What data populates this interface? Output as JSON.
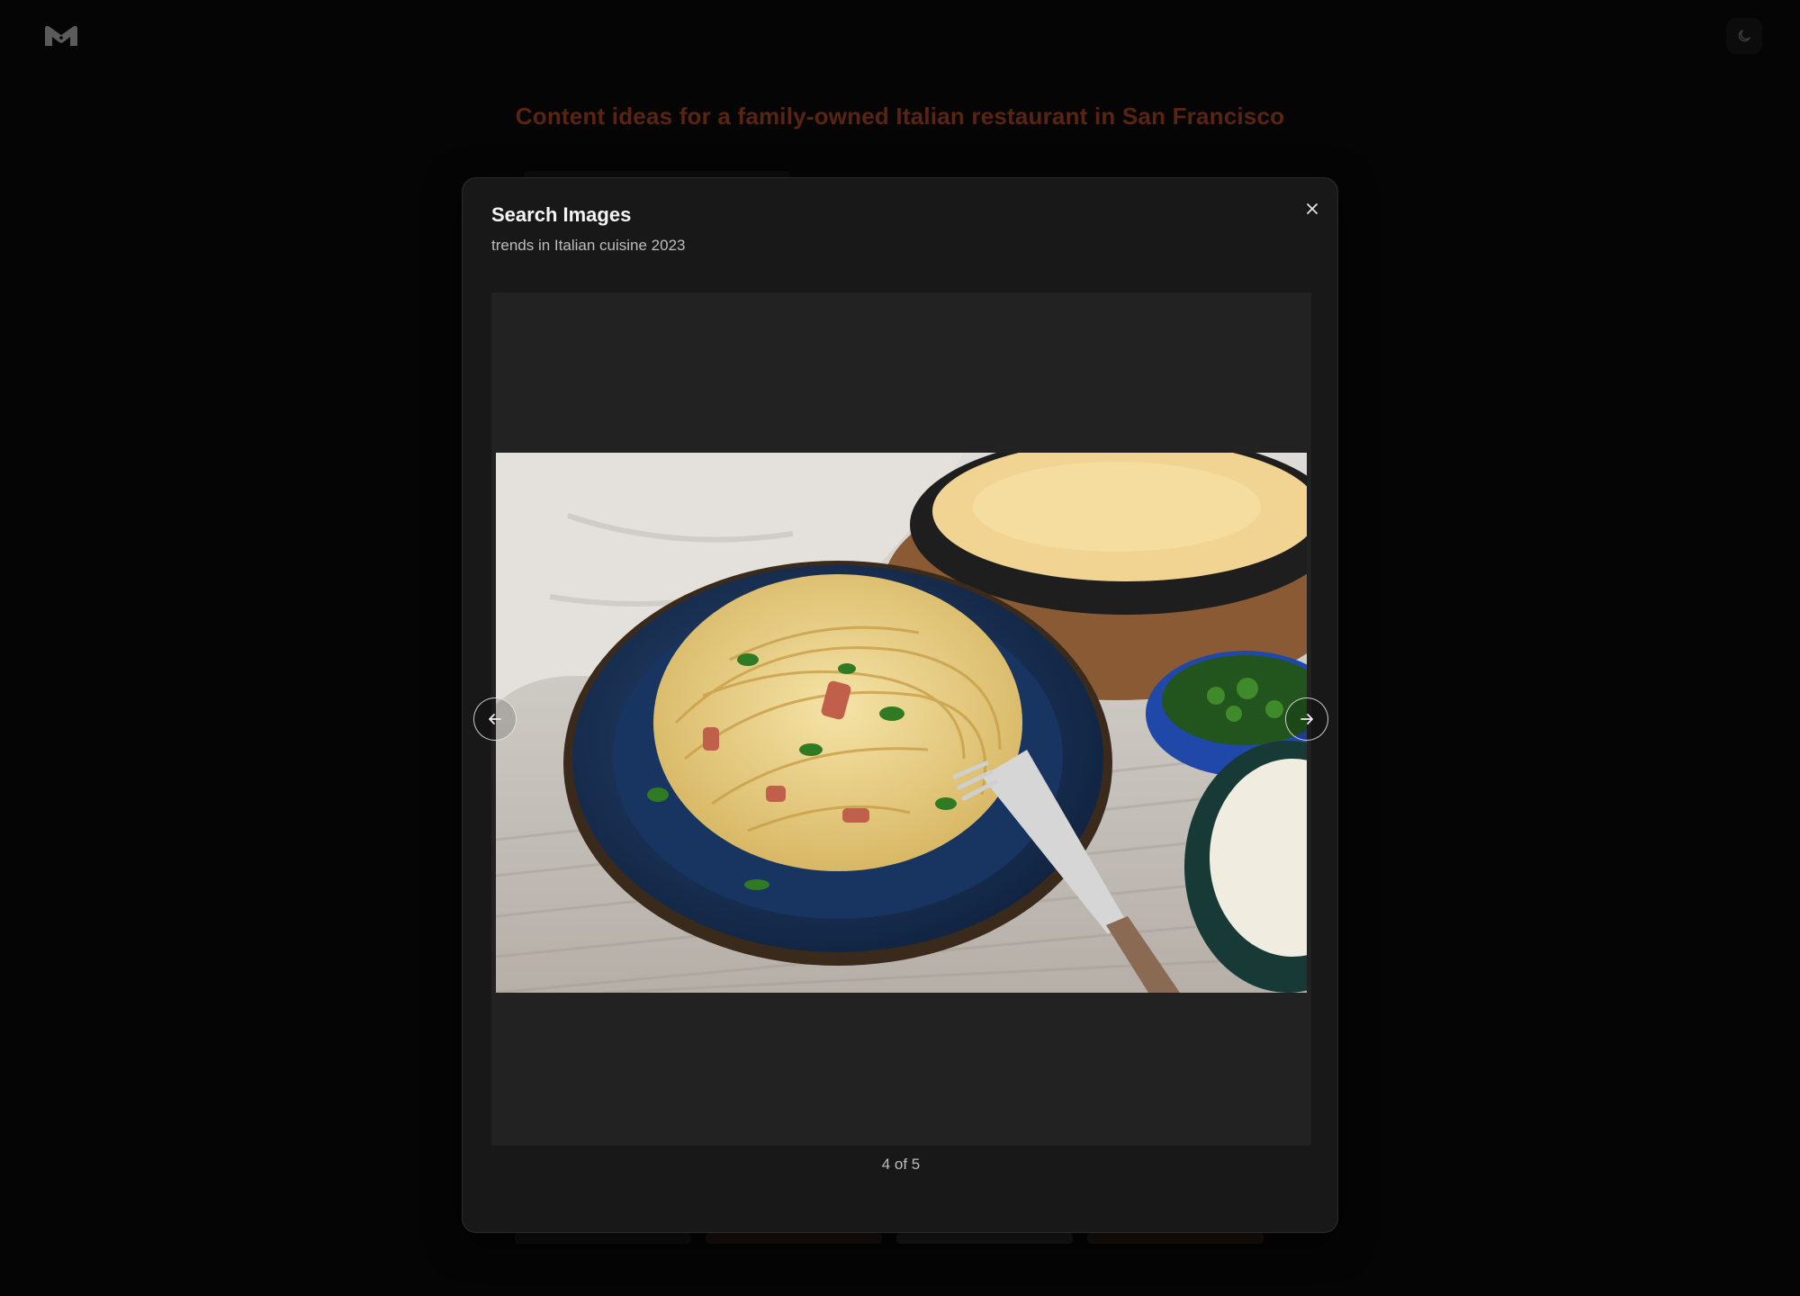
{
  "app": {
    "logo_icon": "m-logo-icon",
    "theme_toggle_icon": "moon-icon",
    "page_title": "Content ideas for a family-owned Italian restaurant in San Francisco",
    "accent_color": "#5a2413"
  },
  "modal": {
    "title": "Search Images",
    "subtitle": "trends in Italian cuisine 2023",
    "close_icon": "close-icon",
    "prev_icon": "arrow-left-icon",
    "next_icon": "arrow-right-icon",
    "image_subject": "spaghetti-carbonara-photo",
    "counter": "4 of 5"
  }
}
